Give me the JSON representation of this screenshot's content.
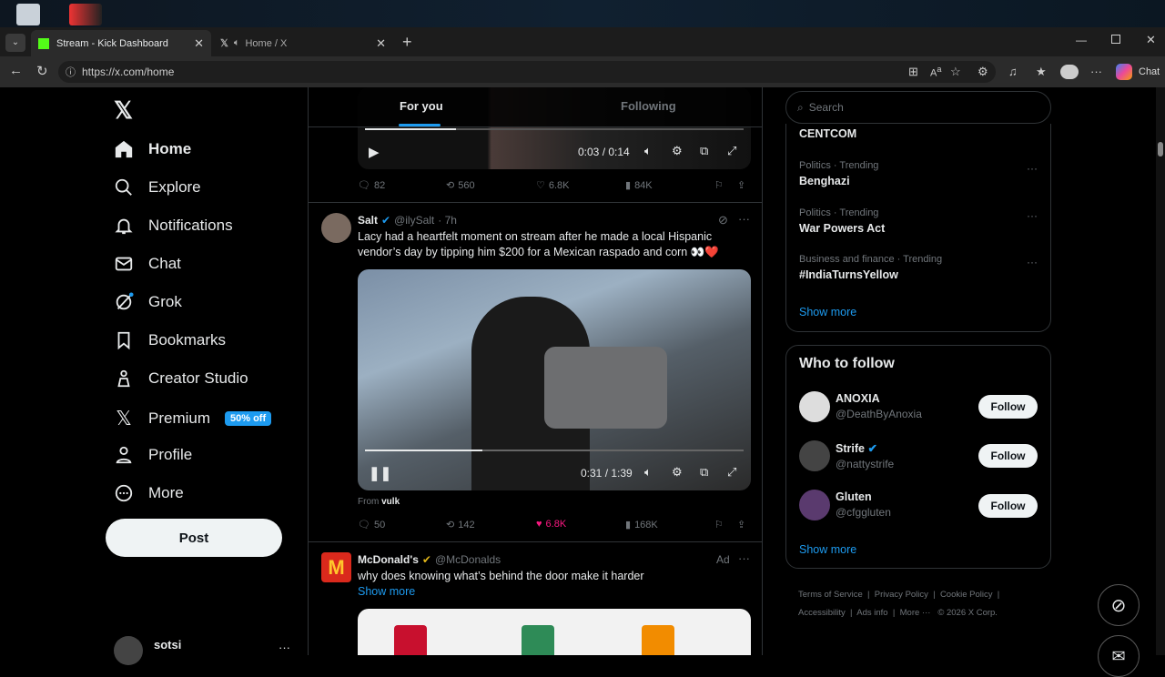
{
  "browser": {
    "tabs": [
      {
        "title": "Stream - Kick Dashboard"
      },
      {
        "title": "Home / X"
      }
    ],
    "url": "https://x.com/home",
    "chat_label": "Chat"
  },
  "nav": {
    "items": [
      {
        "label": "Home",
        "icon": "home-icon"
      },
      {
        "label": "Explore",
        "icon": "search-icon"
      },
      {
        "label": "Notifications",
        "icon": "bell-icon"
      },
      {
        "label": "Chat",
        "icon": "mail-icon"
      },
      {
        "label": "Grok",
        "icon": "grok-icon"
      },
      {
        "label": "Bookmarks",
        "icon": "bookmark-icon"
      },
      {
        "label": "Creator Studio",
        "icon": "creator-icon"
      },
      {
        "label": "Premium",
        "icon": "x-icon"
      },
      {
        "label": "Profile",
        "icon": "person-icon"
      },
      {
        "label": "More",
        "icon": "more-circle-icon"
      }
    ],
    "premium_badge": "50% off",
    "post_label": "Post",
    "account_name": "sotsi"
  },
  "feed": {
    "tabs": [
      "For you",
      "Following"
    ],
    "post1": {
      "time": "0:03 / 0:14",
      "replies": "82",
      "reposts": "560",
      "likes": "6.8K",
      "views": "84K"
    },
    "post2": {
      "name": "Salt",
      "handle": "@ilySalt",
      "age": "· 7h",
      "text": "Lacy had a heartfelt moment on stream after he made a local Hispanic vendor’s day by tipping him $200 for a Mexican raspado and corn 👀❤️",
      "time": "0:31 / 1:39",
      "from_label": "From",
      "from_user": "vulk",
      "replies": "50",
      "reposts": "142",
      "likes": "6.8K",
      "views": "168K",
      "progress": 0.31
    },
    "post3": {
      "name": "McDonald's",
      "handle": "@McDonalds",
      "ad_label": "Ad",
      "text": "why does knowing what’s behind the door make it harder",
      "show_more": "Show more"
    }
  },
  "sidebar": {
    "search_placeholder": "Search",
    "trends": [
      {
        "context": "",
        "name": "CENTCOM"
      },
      {
        "context": "Politics · Trending",
        "name": "Benghazi"
      },
      {
        "context": "Politics · Trending",
        "name": "War Powers Act"
      },
      {
        "context": "Business and finance · Trending",
        "name": "#IndiaTurnsYellow"
      }
    ],
    "trends_show_more": "Show more",
    "who_to_follow_title": "Who to follow",
    "suggestions": [
      {
        "name": "ANOXIA",
        "handle": "@DeathByAnoxia",
        "button": "Follow"
      },
      {
        "name": "Strife",
        "handle": "@nattystrife",
        "button": "Follow"
      },
      {
        "name": "Gluten",
        "handle": "@cfggluten",
        "button": "Follow"
      }
    ],
    "wtf_show_more": "Show more",
    "footer": [
      "Terms of Service",
      "Privacy Policy",
      "Cookie Policy",
      "Accessibility",
      "Ads info",
      "More ···",
      "© 2026 X Corp."
    ]
  },
  "colors": {
    "accent": "#1d9bf0",
    "like": "#f91880",
    "badge": "#1d9bf0"
  }
}
